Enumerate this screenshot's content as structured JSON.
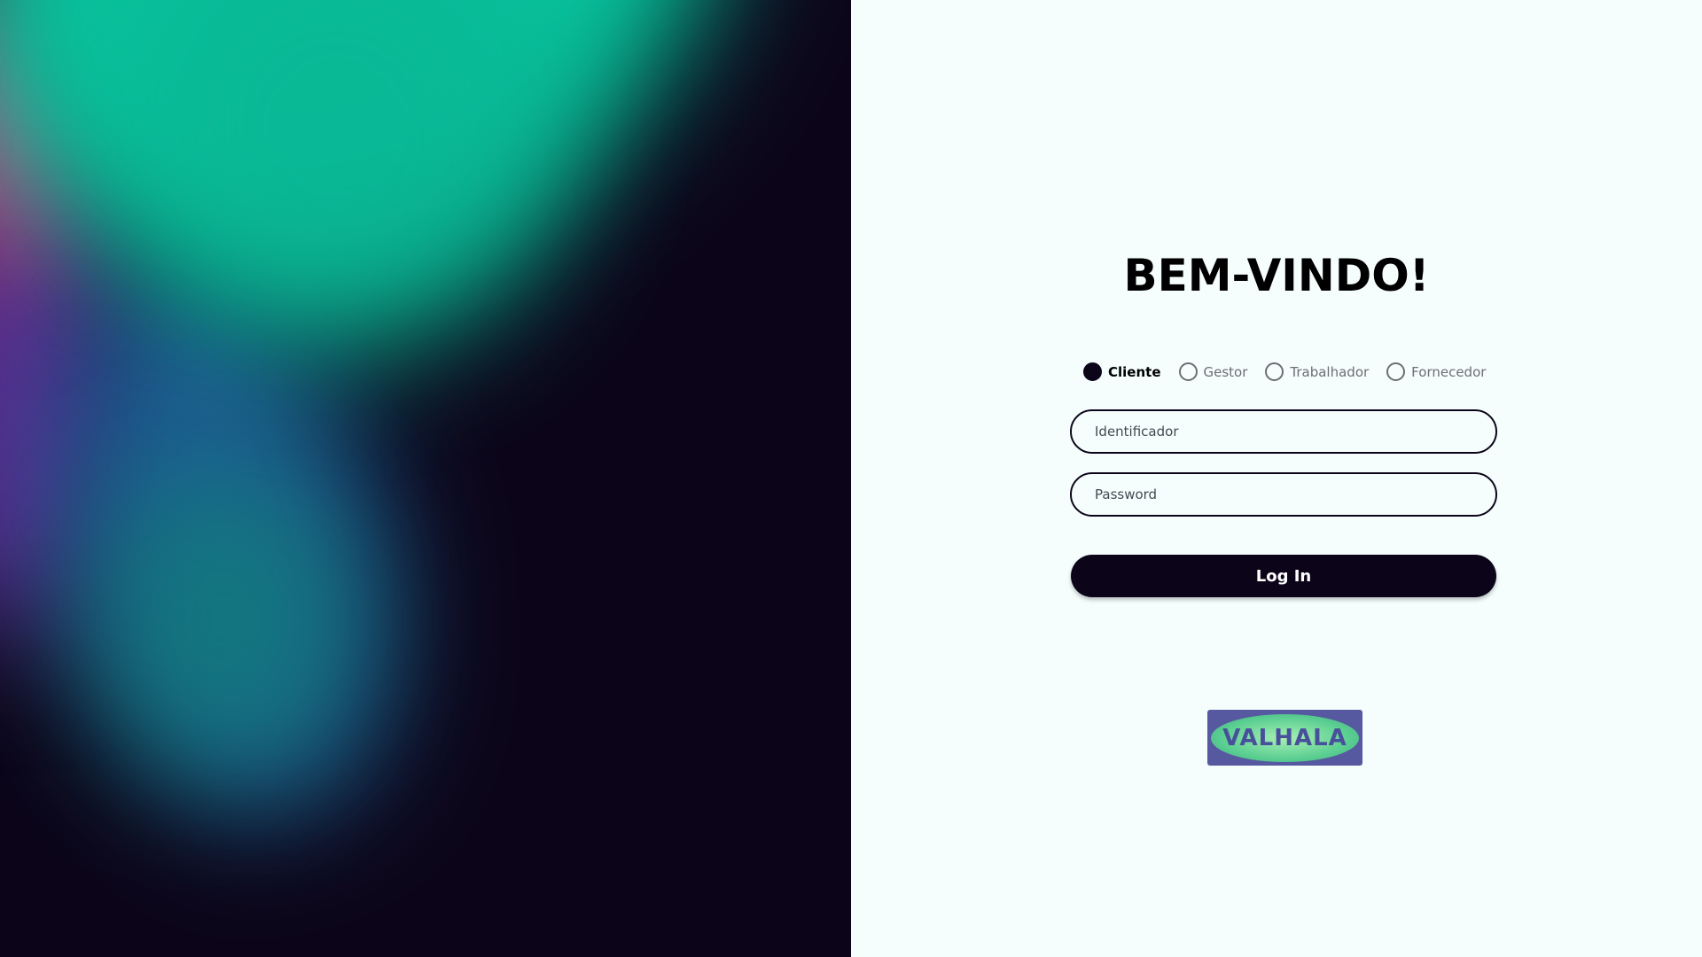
{
  "login": {
    "title": "BEM-VINDO!",
    "roles": [
      {
        "label": "Cliente",
        "selected": true
      },
      {
        "label": "Gestor",
        "selected": false
      },
      {
        "label": "Trabalhador",
        "selected": false
      },
      {
        "label": "Fornecedor",
        "selected": false
      }
    ],
    "identifier_placeholder": "Identificador",
    "identifier_value": "",
    "password_placeholder": "Password",
    "password_value": "",
    "submit_label": "Log In"
  },
  "logo": {
    "text": "VALHALA"
  },
  "colors": {
    "dark": "#0c0519",
    "form_background": "#f5fefd",
    "accent_teal": "#07c39d",
    "accent_pink": "#ee5596",
    "accent_purple": "#5a2d92",
    "accent_blue": "#1d5a93",
    "logo_background": "#56599f",
    "logo_green": "#5ccf92"
  }
}
